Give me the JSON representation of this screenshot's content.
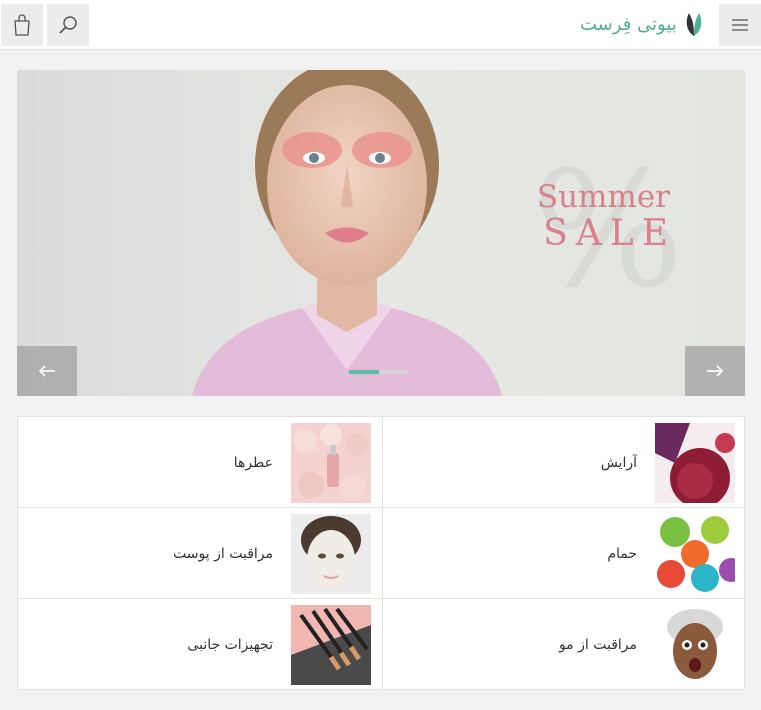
{
  "header": {
    "logo_text": "بیوتی فِرست",
    "search_icon": "search-icon",
    "cart_icon": "shopping-bag-icon",
    "menu_icon": "hamburger-menu-icon"
  },
  "slider": {
    "headline_line1": "Summer",
    "headline_line2": "SALE",
    "watermark": "%",
    "prev_icon": "arrow-left-icon",
    "next_icon": "arrow-right-icon",
    "slide_count": 2,
    "active_slide": 1
  },
  "categories": [
    {
      "label": "آرایش",
      "image": "makeup-image"
    },
    {
      "label": "عطرها",
      "image": "perfume-image"
    },
    {
      "label": "حمام",
      "image": "bath-image"
    },
    {
      "label": "مراقبت از پوست",
      "image": "skincare-image"
    },
    {
      "label": "مراقبت از مو",
      "image": "haircare-image"
    },
    {
      "label": "تجهیزات جانبی",
      "image": "accessories-image"
    }
  ],
  "colors": {
    "brand": "#4fae93",
    "sale_text": "#d98088",
    "active_dot": "#5dbda3"
  }
}
